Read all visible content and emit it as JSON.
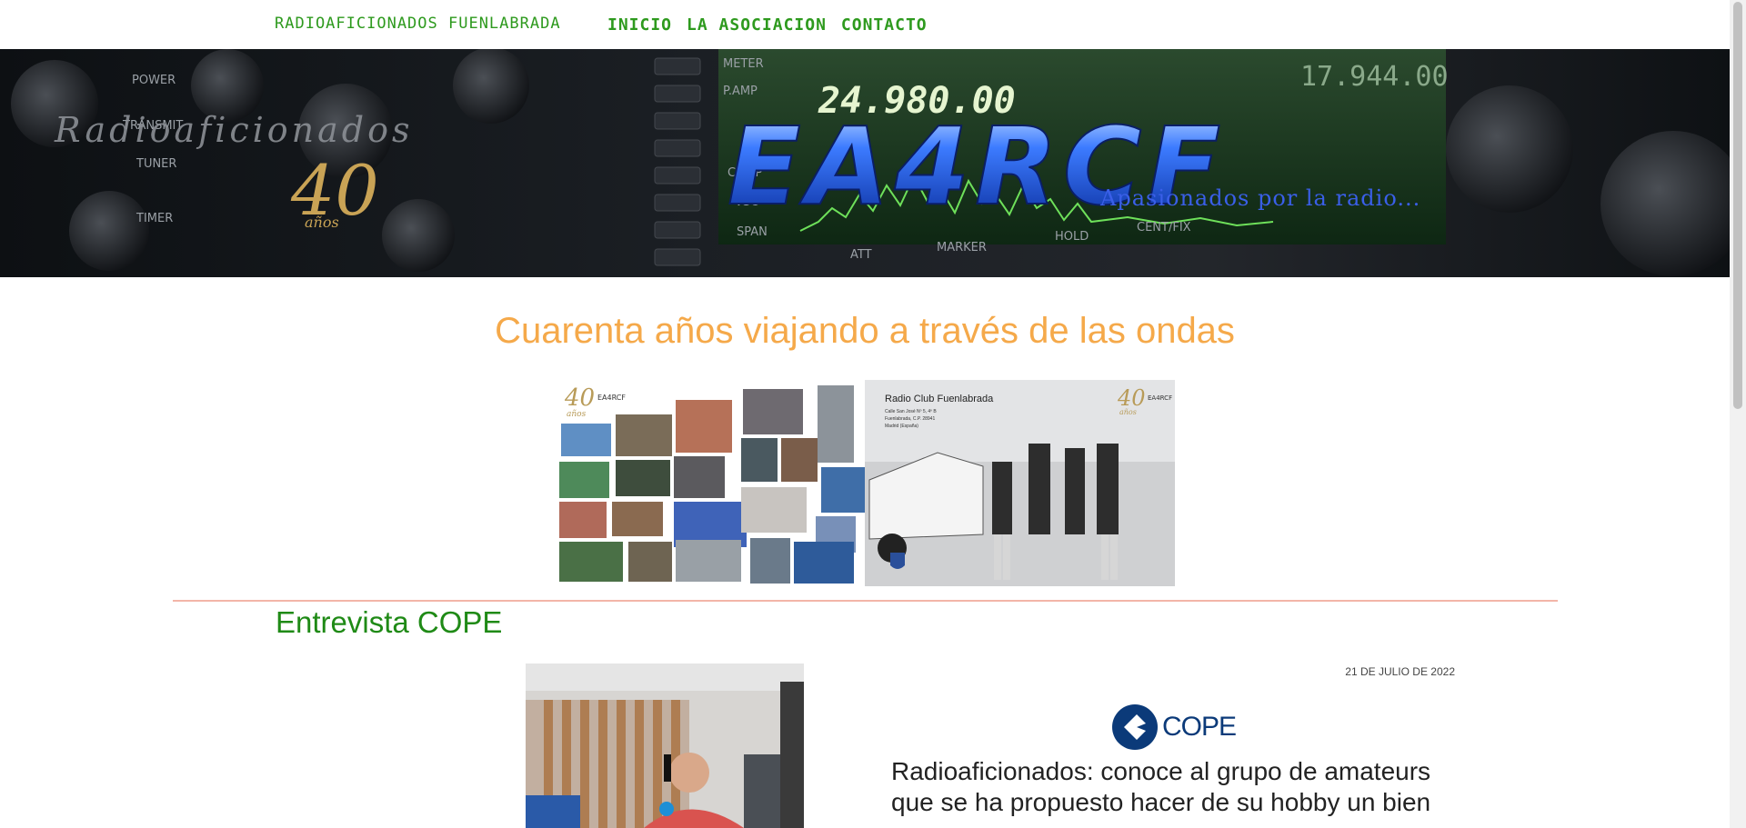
{
  "nav": {
    "brand": "RADIOAFICIONADOS FUENLABRADA",
    "links": [
      {
        "label": "INICIO"
      },
      {
        "label": "LA ASOCIACION"
      },
      {
        "label": "CONTACTO"
      }
    ]
  },
  "banner": {
    "callsign": "EA4RCF",
    "tagline": "Apasionados por la radio...",
    "script_text": "Radioaficionados",
    "anniversary": "40",
    "anniversary_word": "años",
    "frequency": "24.980.00",
    "frequency_secondary": "17.944.00",
    "panel_labels": [
      "POWER",
      "TRANSMIT",
      "TUNER",
      "TIMER",
      "METER",
      "P.AMP",
      "COMP",
      "VSC",
      "SPAN",
      "ATT",
      "MARKER",
      "HOLD",
      "CENT/FIX"
    ]
  },
  "main": {
    "heading": "Cuarenta años viajando a través de las ondas",
    "collage": {
      "right_title": "Radio Club Fuenlabrada",
      "right_address": [
        "Calle San José Nº 5, 4º B",
        "Fuenlabrada, C.P. 28941",
        "Madrid (España)"
      ],
      "badge": "40",
      "badge_callsign": "EA4RCF",
      "badge_word": "años"
    }
  },
  "article": {
    "section_title": "Entrevista COPE",
    "date": "21 DE JULIO DE 2022",
    "logo_text": "COPE",
    "headline": "Radioaficionados: conoce al grupo de amateurs que se ha propuesto hacer de su hobby un bien"
  },
  "colors": {
    "nav_green": "#2e9a1e",
    "heading_orange": "#f5a94a",
    "section_green": "#1f8a16",
    "divider": "#f3b5a8",
    "cope_blue": "#0b3a79"
  }
}
